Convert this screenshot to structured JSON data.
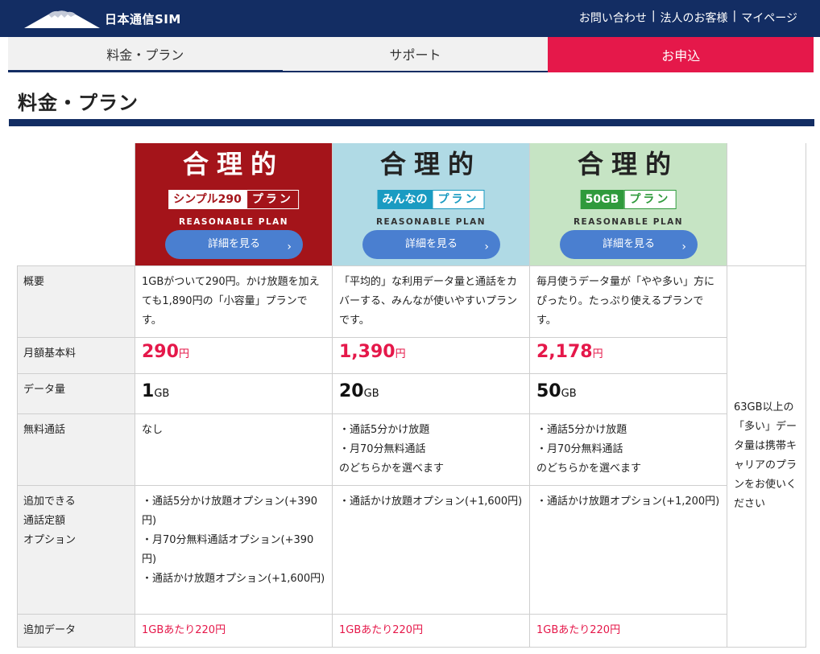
{
  "header": {
    "brand": "日本通信SIM",
    "links": [
      "お問い合わせ",
      "法人のお客様",
      "マイページ"
    ],
    "separator": "|"
  },
  "nav": {
    "tabs": [
      "料金・プラン",
      "サポート",
      "お申込"
    ]
  },
  "page": {
    "title": "料金・プラン"
  },
  "plans": [
    {
      "logo_main": "合理的",
      "badge_a": "シンプル290",
      "badge_b": "プラン",
      "sub": "REASONABLE PLAN",
      "button": "詳細を見る",
      "summary": "1GBがついて290円。かけ放題を加えても1,890円の「小容量」プランです。",
      "price": "290",
      "price_unit": "円",
      "data": "1",
      "data_unit": "GB",
      "free_call": [
        "なし"
      ],
      "options": [
        "・通話5分かけ放題オプション(+390円)",
        "・月70分無料通話オプション(+390円)",
        "・通話かけ放題オプション(+1,600円)"
      ],
      "extra_data": "1GBあたり220円"
    },
    {
      "logo_main": "合理的",
      "badge_a": "みんなの",
      "badge_b": "プラン",
      "sub": "REASONABLE PLAN",
      "button": "詳細を見る",
      "summary": "「平均的」な利用データ量と通話をカバーする、みんなが使いやすいプランです。",
      "price": "1,390",
      "price_unit": "円",
      "data": "20",
      "data_unit": "GB",
      "free_call": [
        "・通話5分かけ放題",
        "・月70分無料通話",
        "のどちらかを選べます"
      ],
      "options": [
        "・通話かけ放題オプション(+1,600円)"
      ],
      "extra_data": "1GBあたり220円"
    },
    {
      "logo_main": "合理的",
      "badge_a": "50GB",
      "badge_b": "プラン",
      "sub": "REASONABLE PLAN",
      "button": "詳細を見る",
      "summary": "毎月使うデータ量が「やや多い」方にぴったり。たっぷり使えるプランです。",
      "price": "2,178",
      "price_unit": "円",
      "data": "50",
      "data_unit": "GB",
      "free_call": [
        "・通話5分かけ放題",
        "・月70分無料通話",
        "のどちらかを選べます"
      ],
      "options": [
        "・通話かけ放題オプション(+1,200円)"
      ],
      "extra_data": "1GBあたり220円"
    }
  ],
  "rows": {
    "summary": "概要",
    "price": "月額基本料",
    "data": "データ量",
    "free_call": "無料通話",
    "options_l1": "追加できる",
    "options_l2": "通話定額",
    "options_l3": "オプション",
    "extra_data": "追加データ"
  },
  "side_note": "63GB以上の「多い」データ量は携帯キャリアのプランをお使いください",
  "colors": {
    "navy": "#132d63",
    "accent_red": "#e5184a",
    "plan1_bg": "#a4141a",
    "plan2_bg": "#b0dae5",
    "plan3_bg": "#c6e4c4",
    "button_blue": "#4a7fd0"
  }
}
